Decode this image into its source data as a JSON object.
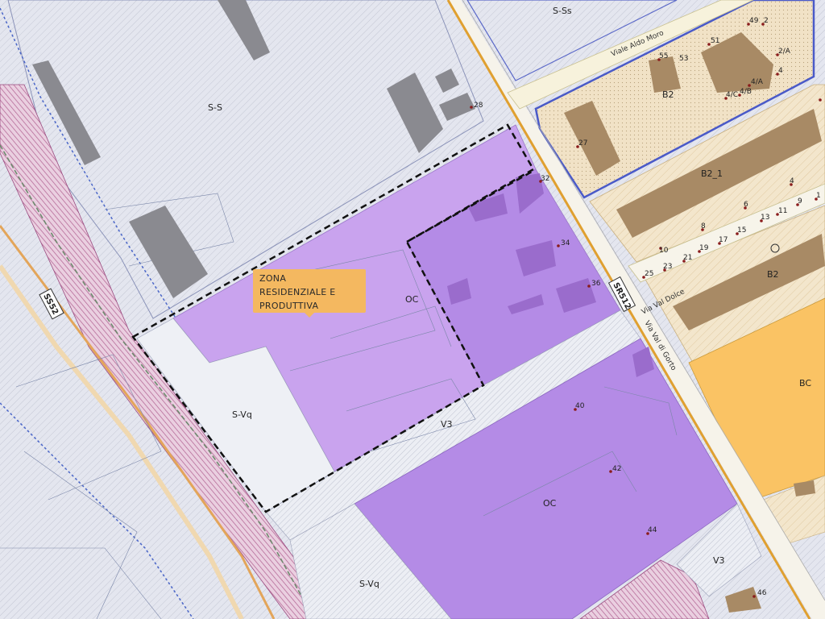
{
  "map": {
    "zones": {
      "s_s": "S-S",
      "s_ss": "S-Ss",
      "b2_top": "B2",
      "b2_1": "B2_1",
      "b2_right": "B2",
      "oc_upper": "OC",
      "oc_lower": "OC",
      "s_vq_upper": "S-Vq",
      "s_vq_lower": "S-Vq",
      "v3_mid": "V3",
      "v3_right": "V3",
      "bc": "BC"
    },
    "roads": {
      "viale_aldo_moro": "Viale Aldo Moro",
      "via_val_dolce": "Via Val Dolce",
      "via_val_di_gorto": "Via Val di Gorto",
      "sr512": "SR512",
      "ss52": "SS52"
    },
    "callout": {
      "line1": "ZONA",
      "line2": "RESIDENZIALE E",
      "line3": "PRODUTTIVA"
    },
    "house_numbers": {
      "n28": "28",
      "n32": "32",
      "n34": "34",
      "n36": "36",
      "n40": "40",
      "n42": "42",
      "n44": "44",
      "n46": "46",
      "n27": "27",
      "n49": "49",
      "n2": "2",
      "n51": "51",
      "n55": "55",
      "n53": "53",
      "n2a": "2/A",
      "n4aa": "4/A",
      "n4": "4",
      "n4c": "4/C",
      "n4b": "4/B",
      "n4r": "4",
      "n6": "6",
      "n8": "8",
      "n10": "10",
      "n11": "11",
      "n13": "13",
      "n15": "15",
      "n17": "17",
      "n19": "19",
      "n21": "21",
      "n23": "23",
      "n25": "25",
      "n9": "9",
      "n1": "1"
    },
    "colors": {
      "background": "#e8eaf2",
      "services_zone": "#e3e5ee",
      "residential_zone": "#f1e2c6",
      "oc_light": "#c9a3ee",
      "oc_dark": "#b48be6",
      "bc_zone": "#fac364",
      "building_grey": "#8a8a90",
      "building_brown": "#a88a65",
      "building_purple": "#9a6ccc",
      "main_road_orange": "#e0a030",
      "railway_hatch": "#b06090",
      "zone_border_blue": "#4a5ac8",
      "callout": "#f4b860"
    }
  }
}
